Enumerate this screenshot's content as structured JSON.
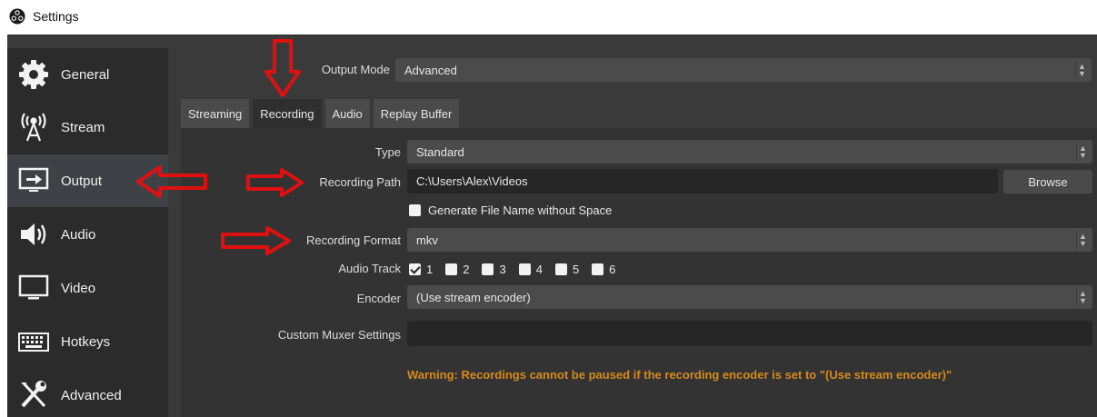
{
  "window": {
    "title": "Settings",
    "app_icon": "obs-logo-icon"
  },
  "sidebar": {
    "items": [
      {
        "label": "General",
        "icon": "gear-icon"
      },
      {
        "label": "Stream",
        "icon": "antenna-icon"
      },
      {
        "label": "Output",
        "icon": "output-monitor-icon",
        "active": true
      },
      {
        "label": "Audio",
        "icon": "speaker-icon"
      },
      {
        "label": "Video",
        "icon": "monitor-icon"
      },
      {
        "label": "Hotkeys",
        "icon": "keyboard-icon"
      },
      {
        "label": "Advanced",
        "icon": "tools-icon"
      }
    ]
  },
  "output_mode": {
    "label": "Output Mode",
    "value": "Advanced"
  },
  "tabs": [
    {
      "label": "Streaming"
    },
    {
      "label": "Recording",
      "active": true
    },
    {
      "label": "Audio"
    },
    {
      "label": "Replay Buffer"
    }
  ],
  "recording": {
    "type": {
      "label": "Type",
      "value": "Standard"
    },
    "path": {
      "label": "Recording Path",
      "value": "C:\\Users\\Alex\\Videos",
      "browse_label": "Browse"
    },
    "generate_name": {
      "label": "Generate File Name without Space",
      "checked": false
    },
    "format": {
      "label": "Recording Format",
      "value": "mkv"
    },
    "audio_track": {
      "label": "Audio Track",
      "tracks": [
        {
          "num": "1",
          "checked": true
        },
        {
          "num": "2",
          "checked": false
        },
        {
          "num": "3",
          "checked": false
        },
        {
          "num": "4",
          "checked": false
        },
        {
          "num": "5",
          "checked": false
        },
        {
          "num": "6",
          "checked": false
        }
      ]
    },
    "encoder": {
      "label": "Encoder",
      "value": "(Use stream encoder)"
    },
    "muxer": {
      "label": "Custom Muxer Settings",
      "value": ""
    },
    "warning": "Warning: Recordings cannot be paused if the recording encoder is set to \"(Use stream encoder)\""
  },
  "colors": {
    "annotation_arrow": "#e01010",
    "warning": "#d68a1a",
    "active_nav": "#3e4247"
  }
}
